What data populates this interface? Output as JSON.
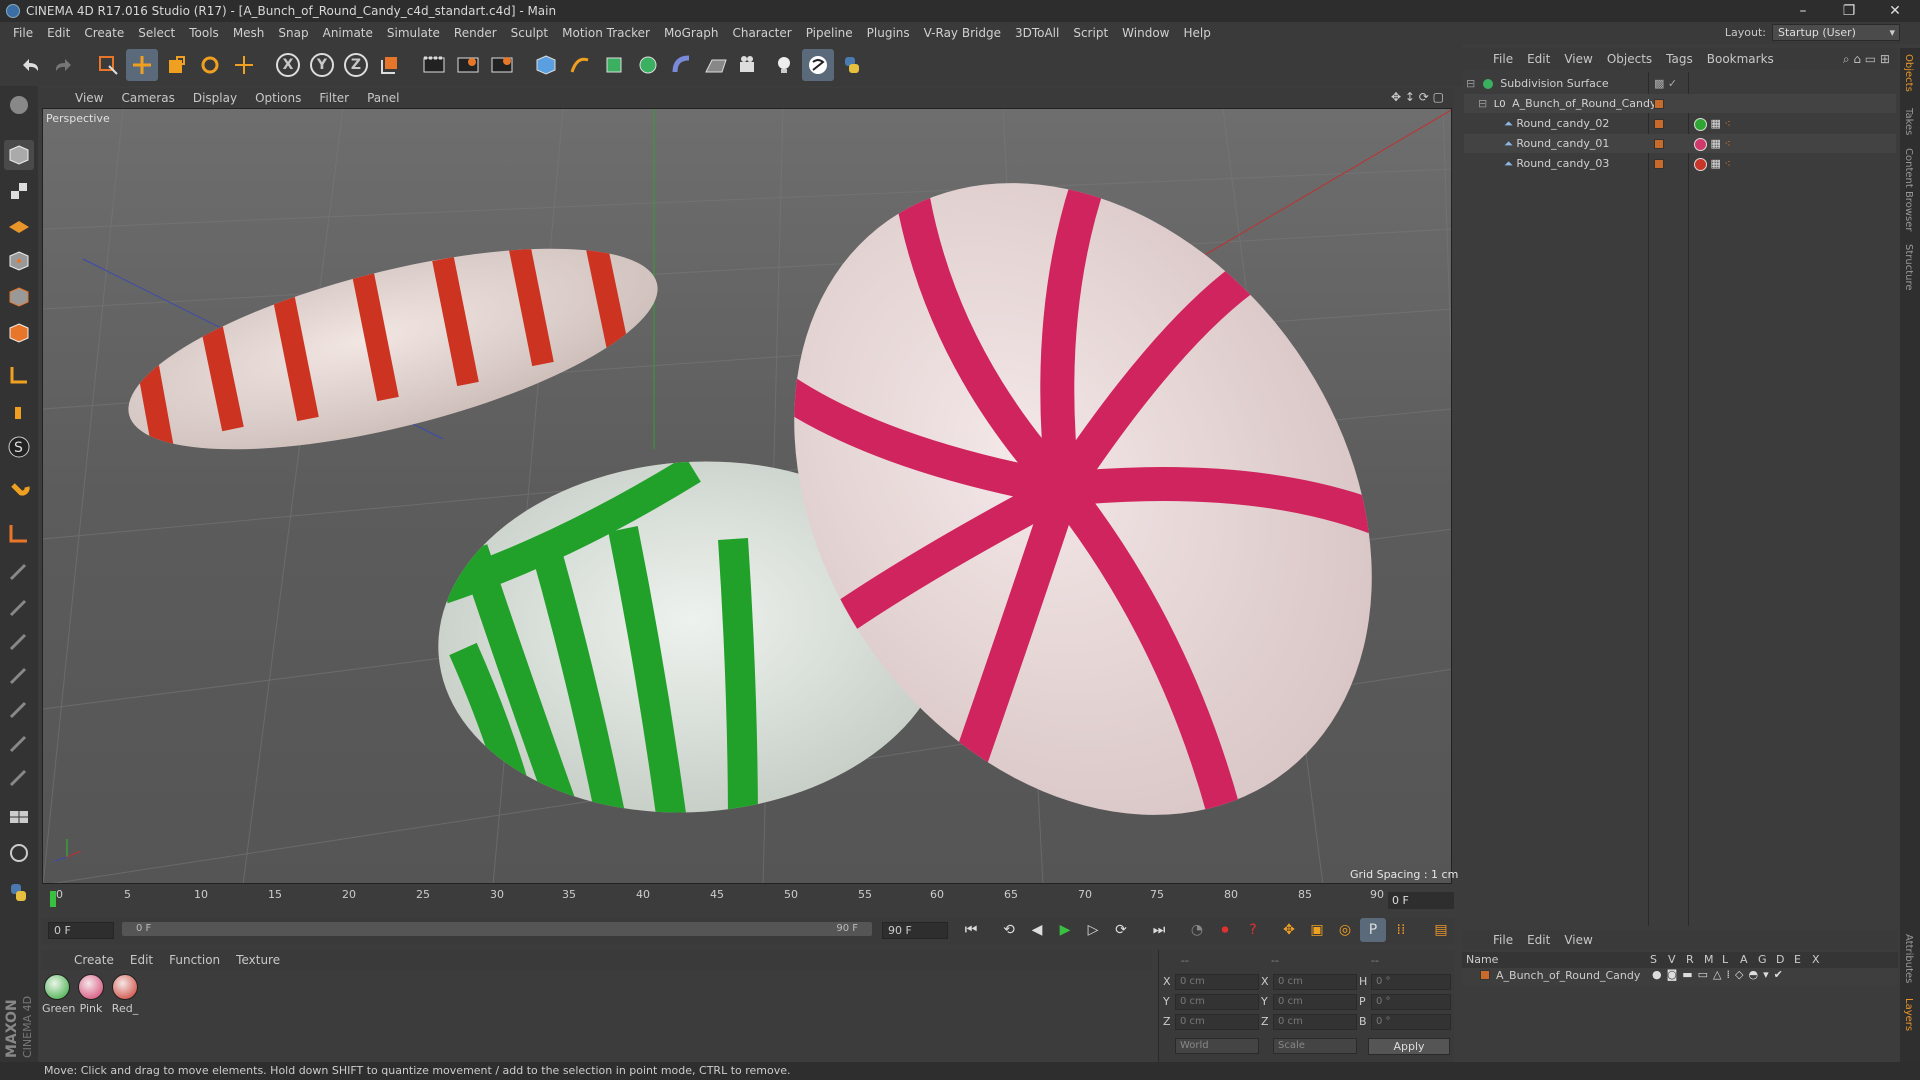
{
  "titlebar": {
    "title": "CINEMA 4D R17.016 Studio (R17) - [A_Bunch_of_Round_Candy_c4d_standart.c4d] - Main",
    "minimize": "–",
    "restore": "❐",
    "close": "✕"
  },
  "menubar": {
    "items": [
      "File",
      "Edit",
      "Create",
      "Select",
      "Tools",
      "Mesh",
      "Snap",
      "Animate",
      "Simulate",
      "Render",
      "Sculpt",
      "Motion Tracker",
      "MoGraph",
      "Character",
      "Pipeline",
      "Plugins",
      "V-Ray Bridge",
      "3DToAll",
      "Script",
      "Window",
      "Help"
    ],
    "layout_label": "Layout:",
    "layout_value": "Startup (User)"
  },
  "toolbar": {
    "x_axis": "X",
    "y_axis": "Y",
    "z_axis": "Z"
  },
  "viewport": {
    "menu": [
      "View",
      "Cameras",
      "Display",
      "Options",
      "Filter",
      "Panel"
    ],
    "camera_label": "Perspective",
    "grid_spacing": "Grid Spacing : 1 cm"
  },
  "timeline": {
    "ticks": [
      "0",
      "5",
      "10",
      "15",
      "20",
      "25",
      "30",
      "35",
      "40",
      "45",
      "50",
      "55",
      "60",
      "65",
      "70",
      "75",
      "80",
      "85",
      "90"
    ],
    "current_frame_right": "0 F",
    "start_field": "0 F",
    "scrub_start": "0 F",
    "scrub_end": "90 F",
    "end_field": "90 F"
  },
  "materials": {
    "menu": [
      "Create",
      "Edit",
      "Function",
      "Texture"
    ],
    "items": [
      {
        "label": "Green",
        "color": "#2fa534"
      },
      {
        "label": "Pink",
        "color": "#d03a6a"
      },
      {
        "label": "Red_",
        "color": "#c8362a"
      }
    ]
  },
  "coordinates": {
    "header_left": "--",
    "header_mid": "--",
    "header_right": "--",
    "rows": [
      {
        "pos_label": "X",
        "pos_value": "0 cm",
        "size_label": "X",
        "size_value": "0 cm",
        "rot_label": "H",
        "rot_value": "0 °"
      },
      {
        "pos_label": "Y",
        "pos_value": "0 cm",
        "size_label": "Y",
        "size_value": "0 cm",
        "rot_label": "P",
        "rot_value": "0 °"
      },
      {
        "pos_label": "Z",
        "pos_value": "0 cm",
        "size_label": "Z",
        "size_value": "0 cm",
        "rot_label": "B",
        "rot_value": "0 °"
      }
    ],
    "mode_world": "World",
    "mode_scale": "Scale",
    "apply": "Apply"
  },
  "object_manager": {
    "menu": [
      "File",
      "Edit",
      "View",
      "Objects",
      "Tags",
      "Bookmarks"
    ],
    "objects": [
      {
        "name": "Subdivision Surface",
        "indent": 0
      },
      {
        "name": "A_Bunch_of_Round_Candy",
        "indent": 1
      },
      {
        "name": "Round_candy_02",
        "indent": 2
      },
      {
        "name": "Round_candy_01",
        "indent": 2
      },
      {
        "name": "Round_candy_03",
        "indent": 2
      }
    ]
  },
  "layer_manager": {
    "menu": [
      "File",
      "Edit",
      "View"
    ],
    "header_name": "Name",
    "header_cols": [
      "S",
      "V",
      "R",
      "M",
      "L",
      "A",
      "G",
      "D",
      "E",
      "X"
    ],
    "row_name": "A_Bunch_of_Round_Candy"
  },
  "sidetabs": [
    "Objects",
    "Takes",
    "Content Browser",
    "Structure",
    "Attributes",
    "Layers"
  ],
  "statusbar": {
    "text": "Move: Click and drag to move elements. Hold down SHIFT to quantize movement / add to the selection in point mode, CTRL to remove."
  },
  "branding": {
    "maxon": "MAXON",
    "cinema": "CINEMA 4D"
  },
  "colors": {
    "accent_orange": "#c86a2a",
    "selection_blue": "#5a6a7a",
    "candy_red": "#c8362a",
    "candy_green": "#2fa534",
    "candy_pink": "#d0245e"
  }
}
